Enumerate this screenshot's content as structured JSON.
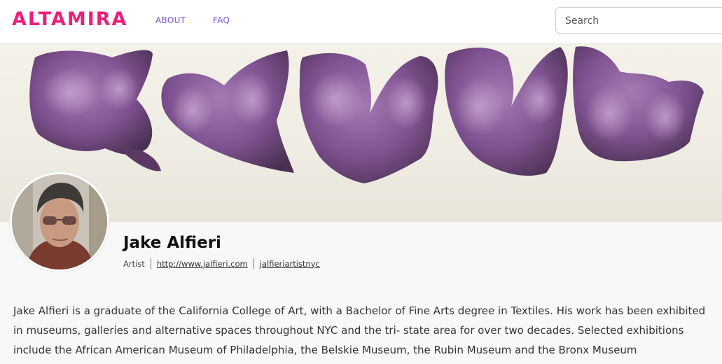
{
  "header": {
    "logo": "ALTAMIRA",
    "nav": {
      "about": "ABOUT",
      "faq": "FAQ"
    },
    "search": {
      "placeholder": "Search",
      "value": ""
    }
  },
  "colors": {
    "brand": "#ec1f7a",
    "nav": "#7b57c9",
    "sculpture": "#8a5a9c"
  },
  "profile": {
    "name": "Jake Alfieri",
    "role": "Artist",
    "website": "http://www.jalfieri.com",
    "handle": "jalfieriartistnyc",
    "bio": "Jake Alfieri is a graduate of the California College of Art, with a Bachelor of Fine Arts degree in Textiles. His work has been exhibited in museums, galleries and alternative spaces throughout NYC and the tri- state area for over two decades. Selected exhibitions include the African American Museum of Philadelphia, the Belskie Museum, the Rubin Museum and the Bronx Museum"
  }
}
